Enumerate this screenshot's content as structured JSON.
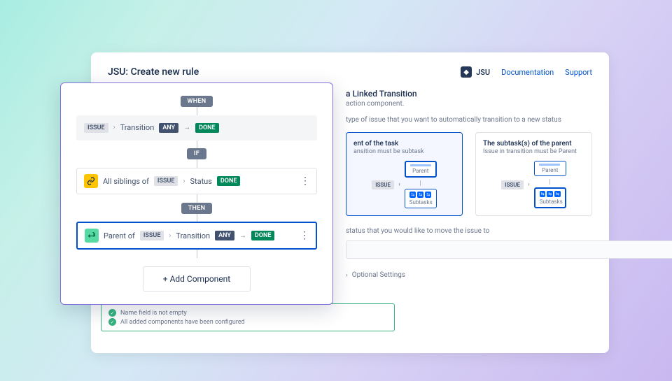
{
  "header": {
    "title": "JSU: Create new rule",
    "brand": "JSU",
    "doc": "Documentation",
    "support": "Support"
  },
  "section": {
    "title": "a Linked Transition",
    "sub": "action component.",
    "pick_sub": "type of issue that you want to automatically transition to a new status"
  },
  "options": {
    "opt1": {
      "title": "ent of the task",
      "sub": "ansition must be subtask",
      "parent": "Parent",
      "subtasks": "Subtasks",
      "issue": "ISSUE"
    },
    "opt2": {
      "title": "The subtask(s) of the parent",
      "sub": "Issue in transition must be Parent",
      "parent": "Parent",
      "subtasks": "Subtasks",
      "issue": "ISSUE"
    }
  },
  "status": {
    "sub": "status that you would like to move the issue to"
  },
  "optional": "Optional Settings",
  "checks": {
    "c1": "Name field is not empty",
    "c2": "All added components have been configured"
  },
  "rule": {
    "when": "WHEN",
    "if": "IF",
    "then": "THEN",
    "issue": "ISSUE",
    "transition": "Transition",
    "any": "ANY",
    "done": "DONE",
    "siblings": "All siblings of",
    "status_lbl": "Status",
    "parent_of": "Parent of",
    "add": "+ Add Component"
  }
}
